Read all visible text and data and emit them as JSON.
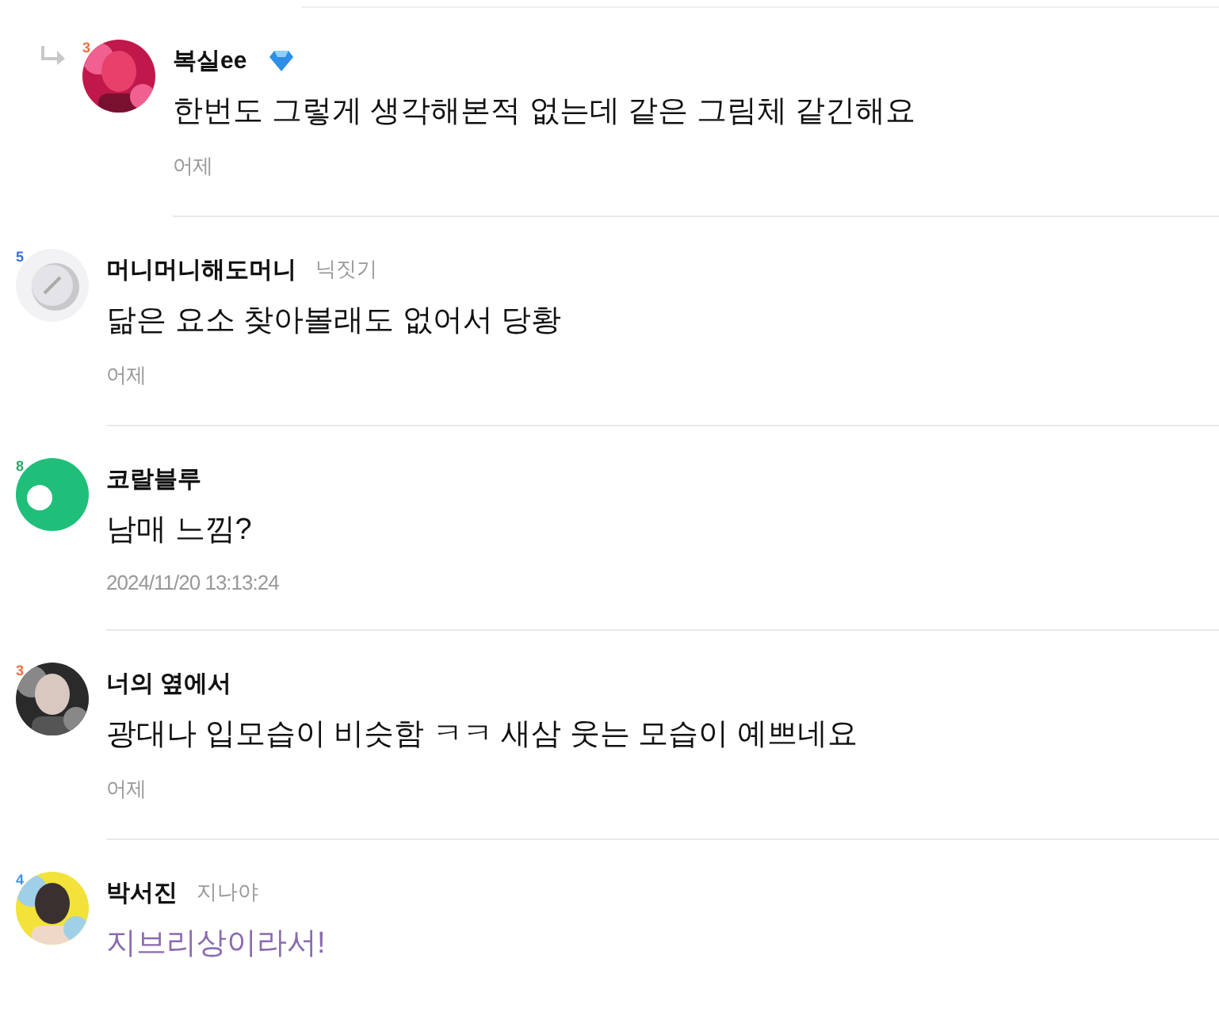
{
  "comments": [
    {
      "is_reply": true,
      "level_badge": {
        "text": "3",
        "color": "#f07040"
      },
      "name": "복실ee",
      "name_icon": true,
      "body": "한번도 그렇게 생각해본적 없는데 같은 그림체 같긴해요",
      "highlighted": false,
      "time": "어제"
    },
    {
      "is_reply": false,
      "avatar": {
        "kind": "coin"
      },
      "level_badge": {
        "text": "5",
        "color": "#3b6fe0"
      },
      "name": "머니머니해도머니",
      "name_icon": false,
      "tag": "닉짓기",
      "body": "닮은 요소 찾아볼래도 없어서 당황",
      "highlighted": false,
      "time": "어제"
    },
    {
      "is_reply": false,
      "avatar": {
        "kind": "ring"
      },
      "level_badge": {
        "text": "8",
        "color": "#2fa86a"
      },
      "name": "코랄블루",
      "name_icon": false,
      "body": "남매 느낌?",
      "highlighted": false,
      "time": "2024/11/20 13:13:24"
    },
    {
      "is_reply": false,
      "level_badge": {
        "text": "3",
        "color": "#f07040"
      },
      "name": "너의 옆에서",
      "name_icon": false,
      "body": "광대나 입모습이 비슷함 ㅋㅋ 새삼 웃는 모습이 예쁘네요",
      "highlighted": false,
      "time": "어제"
    },
    {
      "is_reply": false,
      "level_badge": {
        "text": "4",
        "color": "#3b8ff0"
      },
      "name": "박서진",
      "name_icon": false,
      "tag": "지나야",
      "body": "지브리상이라서!",
      "highlighted": true
    }
  ]
}
